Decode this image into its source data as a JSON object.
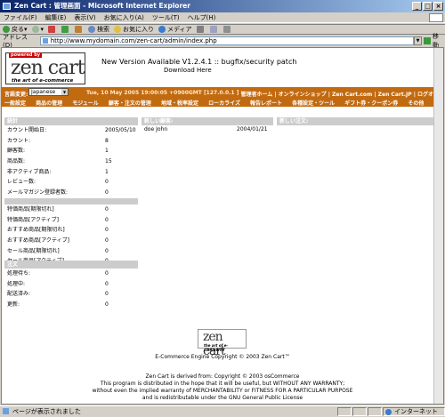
{
  "window": {
    "title": "Zen Cart : 管理画面 - Microsoft Internet Explorer"
  },
  "menu": [
    "ファイル(F)",
    "編集(E)",
    "表示(V)",
    "お気に入り(A)",
    "ツール(T)",
    "ヘルプ(H)"
  ],
  "toolbar": {
    "back": "戻る",
    "search": "検索",
    "favorites": "お気に入り",
    "media": "メディア"
  },
  "address": {
    "label": "アドレス(D)",
    "url": "http://www.mydomain.com/zen-cart/admin/index.php",
    "go": "移動"
  },
  "header": {
    "logo_tag": "powered by",
    "logo_text": "zen cart",
    "logo_sub": "the art of e-commerce",
    "notice_line1": "New Version Available V1.2.4.1 :: bugfix/security patch",
    "notice_line2": "Download Here",
    "lang_label": "言語変更:",
    "lang_value": "Japanese",
    "datetime": "Tue, 10 May 2005 19:00:05 +0900GMT [127.0.0.1 ]",
    "toplinks": "管理者ホーム | オンラインショップ | Zen Cart.com | Zen Cart.JP | ログオフ",
    "nav": [
      "一般設定",
      "商品の管理",
      "モジュール",
      "顧客・注文の管理",
      "地域・税率設定",
      "ローカライズ",
      "報告レポート",
      "各種設定・ツール",
      "ギフト券・クーポン券",
      "その他"
    ]
  },
  "stats": {
    "header": "統計",
    "rows": [
      {
        "label": "カウント開始日:",
        "value": "2005/05/10"
      },
      {
        "label": "カウント:",
        "value": "8"
      },
      {
        "label": "顧客数:",
        "value": "1"
      },
      {
        "label": "商品数:",
        "value": "15"
      },
      {
        "label": "非アクティブ商品:",
        "value": "1"
      },
      {
        "label": "レビュー数:",
        "value": "0"
      },
      {
        "label": "メールマガジン登録者数:",
        "value": "0"
      }
    ],
    "rows2": [
      {
        "label": "特価商品[期限切れ]",
        "value": "0"
      },
      {
        "label": "特価商品[アクティブ]",
        "value": "0"
      },
      {
        "label": "おすすめ商品[期限切れ]",
        "value": "0"
      },
      {
        "label": "おすすめ商品[アクティブ]",
        "value": "0"
      },
      {
        "label": "セール商品[期限切れ]",
        "value": "0"
      },
      {
        "label": "セール商品[アクティブ]",
        "value": "0"
      }
    ]
  },
  "orders_status": {
    "header": "注文",
    "rows": [
      {
        "label": "処理待ち:",
        "value": "0"
      },
      {
        "label": "処理中:",
        "value": "0"
      },
      {
        "label": "配送済み:",
        "value": "0"
      },
      {
        "label": "更新:",
        "value": "0"
      }
    ]
  },
  "new_customers": {
    "header": "新しい顧客:",
    "rows": [
      {
        "name": "doe John",
        "date": "2004/01/21"
      }
    ]
  },
  "new_orders": {
    "header": "新しい注文:"
  },
  "footer": {
    "logo_text": "zen cart",
    "logo_sub": "the art of e-commerce",
    "copyright": "E-Commerce Engine Copyright © 2003 Zen Cart™",
    "line1": "Zen Cart is derived from: Copyright © 2003 osCommerce",
    "line2": "This program is distributed in the hope that it will be useful, but WITHOUT ANY WARRANTY;",
    "line3": "without even the implied warranty of MERCHANTABILITY or FITNESS FOR A PARTICULAR PURPOSE",
    "line4": "and is redistributable under the GNU General Public License"
  },
  "status": {
    "text": "ページが表示されました",
    "zone": "インターネット"
  }
}
